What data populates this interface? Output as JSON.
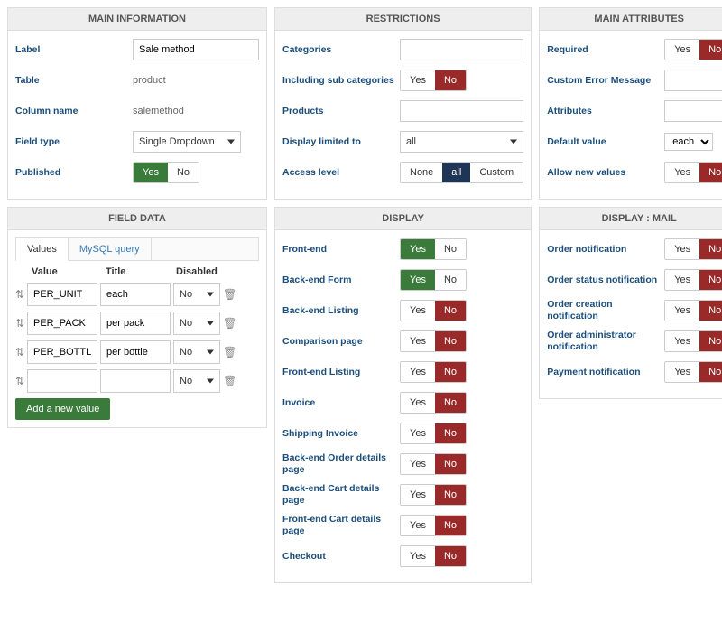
{
  "yes": "Yes",
  "no": "No",
  "mainInfo": {
    "title": "MAIN INFORMATION",
    "label": {
      "lbl": "Label",
      "val": "Sale method"
    },
    "table": {
      "lbl": "Table",
      "val": "product"
    },
    "col": {
      "lbl": "Column name",
      "val": "salemethod"
    },
    "ftype": {
      "lbl": "Field type",
      "val": "Single Dropdown"
    },
    "pub": {
      "lbl": "Published",
      "on": "yes"
    }
  },
  "restrictions": {
    "title": "RESTRICTIONS",
    "cat": {
      "lbl": "Categories",
      "val": ""
    },
    "incsub": {
      "lbl": "Including sub categories",
      "on": "no"
    },
    "prod": {
      "lbl": "Products",
      "val": ""
    },
    "disp": {
      "lbl": "Display limited to",
      "val": "all"
    },
    "access": {
      "lbl": "Access level",
      "opts": [
        "None",
        "all",
        "Custom"
      ],
      "sel": 1
    }
  },
  "mainAttr": {
    "title": "MAIN ATTRIBUTES",
    "req": {
      "lbl": "Required",
      "on": "no"
    },
    "err": {
      "lbl": "Custom Error Message",
      "val": ""
    },
    "attr": {
      "lbl": "Attributes",
      "val": ""
    },
    "def": {
      "lbl": "Default value",
      "val": "each"
    },
    "allow": {
      "lbl": "Allow new values",
      "on": "no"
    }
  },
  "fieldData": {
    "title": "FIELD DATA",
    "tabs": [
      "Values",
      "MySQL query"
    ],
    "hdr": {
      "v": "Value",
      "t": "Title",
      "d": "Disabled"
    },
    "rows": [
      {
        "v": "PER_UNIT",
        "t": "each",
        "d": "No"
      },
      {
        "v": "PER_PACK",
        "t": "per pack",
        "d": "No"
      },
      {
        "v": "PER_BOTTLE",
        "t": "per bottle",
        "d": "No"
      },
      {
        "v": "",
        "t": "",
        "d": "No"
      }
    ],
    "add": "Add a new value"
  },
  "display": {
    "title": "DISPLAY",
    "rows": [
      {
        "lbl": "Front-end",
        "on": "yes"
      },
      {
        "lbl": "Back-end Form",
        "on": "yes"
      },
      {
        "lbl": "Back-end Listing",
        "on": "no"
      },
      {
        "lbl": "Comparison page",
        "on": "no"
      },
      {
        "lbl": "Front-end Listing",
        "on": "no"
      },
      {
        "lbl": "Invoice",
        "on": "no"
      },
      {
        "lbl": "Shipping Invoice",
        "on": "no"
      },
      {
        "lbl": "Back-end Order details page",
        "on": "no"
      },
      {
        "lbl": "Back-end Cart details page",
        "on": "no"
      },
      {
        "lbl": "Front-end Cart details page",
        "on": "no"
      },
      {
        "lbl": "Checkout",
        "on": "no"
      }
    ]
  },
  "displayMail": {
    "title": "DISPLAY : MAIL",
    "rows": [
      {
        "lbl": "Order notification",
        "on": "no"
      },
      {
        "lbl": "Order status notification",
        "on": "no"
      },
      {
        "lbl": "Order creation notification",
        "on": "no"
      },
      {
        "lbl": "Order administrator notification",
        "on": "no"
      },
      {
        "lbl": "Payment notification",
        "on": "no"
      }
    ]
  }
}
